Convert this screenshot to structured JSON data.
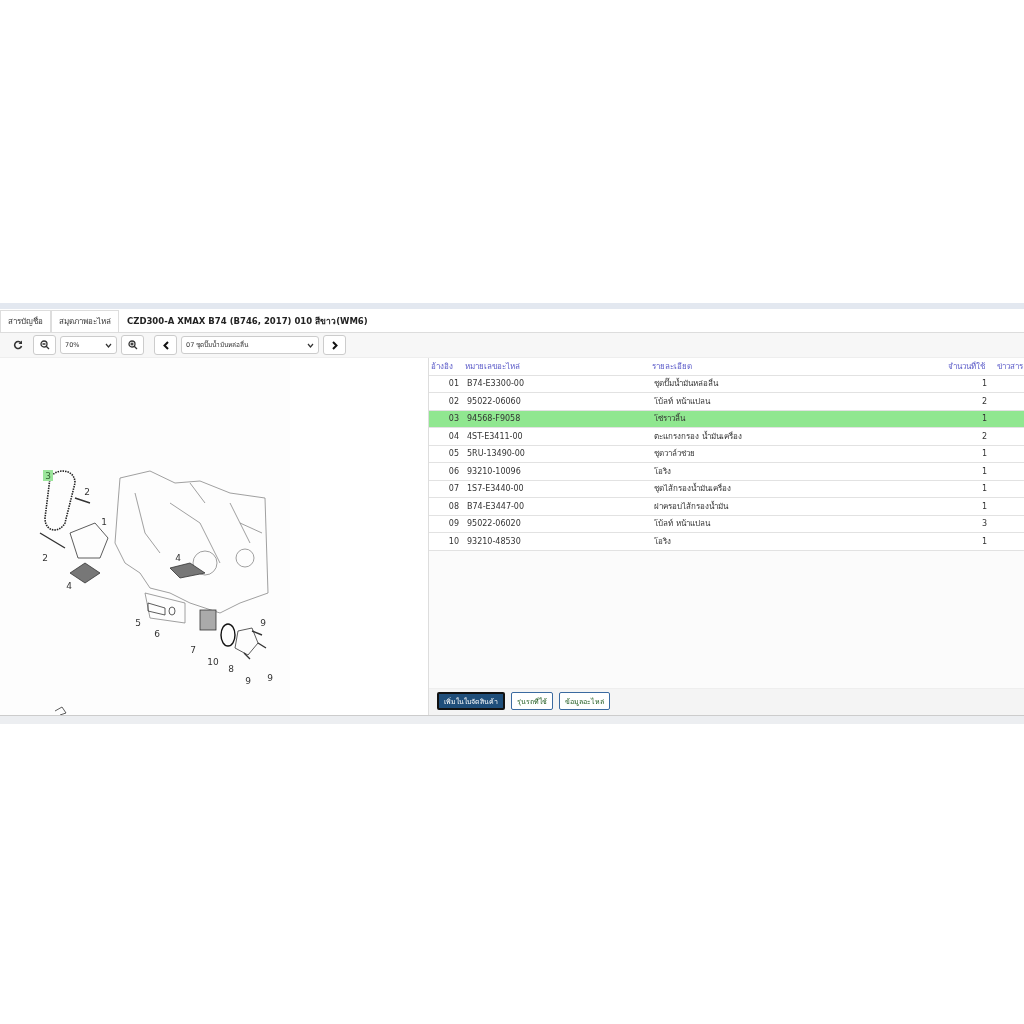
{
  "tabs": [
    "สารบัญชื่อ",
    "สมุดภาพอะไหล่"
  ],
  "title": "CZD300-A XMAX B74 (B746, 2017) 010 สีขาว(WM6)",
  "toolbar": {
    "zoom": "70%",
    "section": "07 ชุดปั๊มน้ำมันหล่อลื่น"
  },
  "diagram": {
    "callouts": [
      {
        "label": "3",
        "highlighted": true
      },
      {
        "label": "2",
        "highlighted": false
      },
      {
        "label": "1",
        "highlighted": false
      },
      {
        "label": "2",
        "highlighted": false
      },
      {
        "label": "4",
        "highlighted": false
      },
      {
        "label": "4",
        "highlighted": false
      },
      {
        "label": "5",
        "highlighted": false
      },
      {
        "label": "6",
        "highlighted": false
      },
      {
        "label": "7",
        "highlighted": false
      },
      {
        "label": "10",
        "highlighted": false
      },
      {
        "label": "8",
        "highlighted": false
      },
      {
        "label": "9",
        "highlighted": false
      },
      {
        "label": "9",
        "highlighted": false
      },
      {
        "label": "9",
        "highlighted": false
      }
    ]
  },
  "table": {
    "columns": [
      "อ้างอิง",
      "หมายเลขอะไหล่",
      "รายละเอียด",
      "จำนวนที่ใช้",
      "ข่าวสาร"
    ],
    "rows": [
      {
        "ref": "01",
        "part": "B74-E3300-00",
        "desc": "ชุดปั๊มน้ำมันหล่อลื่น",
        "qty": "1",
        "selected": false
      },
      {
        "ref": "02",
        "part": "95022-06060",
        "desc": "โบ้ลท์ หน้าแปลน",
        "qty": "2",
        "selected": false
      },
      {
        "ref": "03",
        "part": "94568-F9058",
        "desc": "โซ่ราวลิ้น",
        "qty": "1",
        "selected": true
      },
      {
        "ref": "04",
        "part": "4ST-E3411-00",
        "desc": "ตะแกรงกรอง น้ำมันเครื่อง",
        "qty": "2",
        "selected": false
      },
      {
        "ref": "05",
        "part": "5RU-13490-00",
        "desc": "ชุดวาล์วช่วย",
        "qty": "1",
        "selected": false
      },
      {
        "ref": "06",
        "part": "93210-10096",
        "desc": "โอริง",
        "qty": "1",
        "selected": false
      },
      {
        "ref": "07",
        "part": "1S7-E3440-00",
        "desc": "ชุดไส้กรองน้ำมันเครื่อง",
        "qty": "1",
        "selected": false
      },
      {
        "ref": "08",
        "part": "B74-E3447-00",
        "desc": "ฝาครอบไส้กรองน้ำมัน",
        "qty": "1",
        "selected": false
      },
      {
        "ref": "09",
        "part": "95022-06020",
        "desc": "โบ้ลท์ หน้าแปลน",
        "qty": "3",
        "selected": false
      },
      {
        "ref": "10",
        "part": "93210-48530",
        "desc": "โอริง",
        "qty": "1",
        "selected": false
      }
    ]
  },
  "buttons": [
    {
      "label": "เพิ่มในใบจัดสินค้า",
      "kind": "primary"
    },
    {
      "label": "รุ่นรถที่ใช้",
      "kind": "outline"
    },
    {
      "label": "ข้อมูลอะไหล่",
      "kind": "outline"
    }
  ]
}
